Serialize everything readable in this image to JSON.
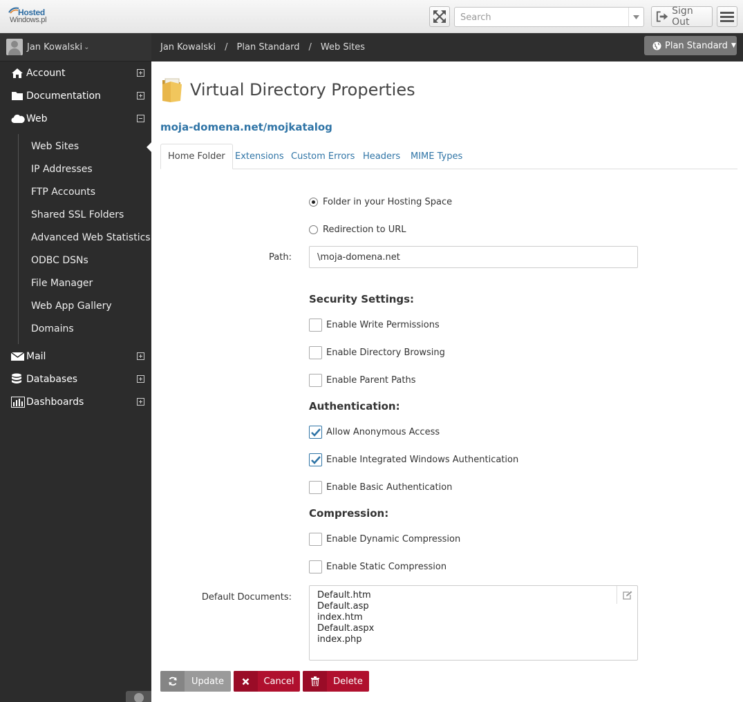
{
  "header": {
    "logo_line1": "Hosted",
    "logo_line2": "Windows.pl",
    "search_placeholder": "Search",
    "signout_label": "Sign Out"
  },
  "sidebar": {
    "user_name": "Jan Kowalski",
    "items": [
      {
        "label": "Account",
        "icon": "home-icon",
        "state": "plus"
      },
      {
        "label": "Documentation",
        "icon": "folder-icon",
        "state": "plus"
      },
      {
        "label": "Web",
        "icon": "cloud-icon",
        "state": "minus"
      },
      {
        "label": "Mail",
        "icon": "envelope-icon",
        "state": "plus"
      },
      {
        "label": "Databases",
        "icon": "database-icon",
        "state": "plus"
      },
      {
        "label": "Dashboards",
        "icon": "bar-chart-icon",
        "state": "plus"
      }
    ],
    "web_subitems": [
      "Web Sites",
      "IP Addresses",
      "FTP Accounts",
      "Shared SSL Folders",
      "Advanced Web Statistics",
      "ODBC DSNs",
      "File Manager",
      "Web App Gallery",
      "Domains"
    ],
    "active_subitem": "Web Sites"
  },
  "breadcrumb": {
    "items": [
      "Jan Kowalski",
      "Plan Standard",
      "Web Sites"
    ],
    "plan_button": "Plan Standard"
  },
  "main": {
    "title": "Virtual Directory Properties",
    "domain_link": "moja-domena.net/mojkatalog",
    "tabs": [
      {
        "label": "Home Folder",
        "active": true
      },
      {
        "label": "Extensions",
        "active": false
      },
      {
        "label": "Custom Errors",
        "active": false
      },
      {
        "label": "Headers",
        "active": false
      },
      {
        "label": "MIME Types",
        "active": false
      }
    ],
    "location_options": [
      {
        "label": "Folder in your Hosting Space",
        "selected": true
      },
      {
        "label": "Redirection to URL",
        "selected": false
      }
    ],
    "path_label": "Path:",
    "path_value": "\\moja-domena.net",
    "security_heading": "Security Settings:",
    "security_options": [
      {
        "label": "Enable Write Permissions",
        "checked": false
      },
      {
        "label": "Enable Directory Browsing",
        "checked": false
      },
      {
        "label": "Enable Parent Paths",
        "checked": false
      }
    ],
    "auth_heading": "Authentication:",
    "auth_options": [
      {
        "label": "Allow Anonymous Access",
        "checked": true
      },
      {
        "label": "Enable Integrated Windows Authentication",
        "checked": true
      },
      {
        "label": "Enable Basic Authentication",
        "checked": false
      }
    ],
    "compression_heading": "Compression:",
    "compression_options": [
      {
        "label": "Enable Dynamic Compression",
        "checked": false
      },
      {
        "label": "Enable Static Compression",
        "checked": false
      }
    ],
    "default_docs_label": "Default Documents:",
    "default_docs": [
      "Default.htm",
      "Default.asp",
      "index.htm",
      "Default.aspx",
      "index.php"
    ],
    "buttons": {
      "update": "Update",
      "cancel": "Cancel",
      "delete": "Delete"
    }
  },
  "colors": {
    "link": "#2f74a6",
    "sidebar_bg": "#2c2c2c",
    "danger": "#b0102e",
    "neutral_button": "#9a9a9a"
  }
}
